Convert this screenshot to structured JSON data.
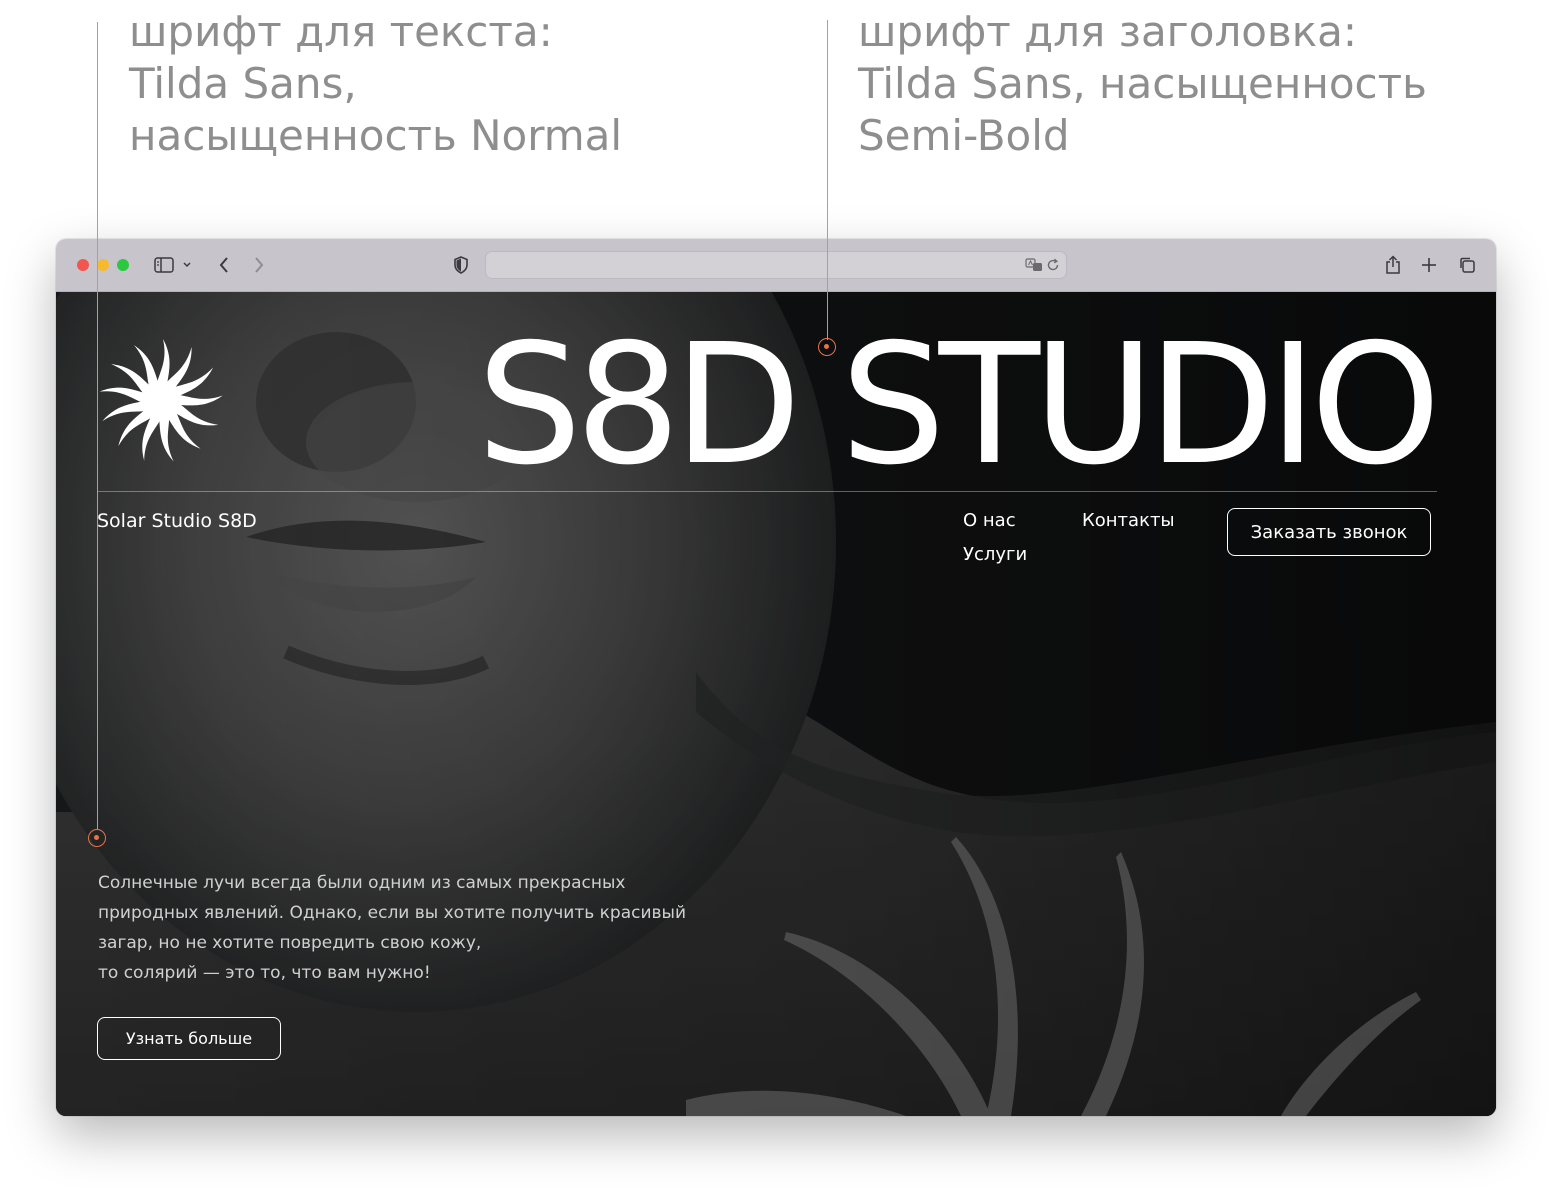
{
  "annotations": {
    "text_font": [
      "шрифт для текста:",
      "Tilda Sans,",
      "насыщенность Normal"
    ],
    "heading_font": [
      "шрифт для заголовка:",
      "Tilda Sans, насыщенность",
      "Semi-Bold"
    ]
  },
  "browser": {
    "address_value": "",
    "icons": [
      "sidebar-icon",
      "chevron-down-icon",
      "back-icon",
      "forward-icon",
      "shield-icon",
      "translate-icon",
      "reload-icon",
      "share-icon",
      "plus-icon",
      "tabs-icon"
    ]
  },
  "site": {
    "title": "S8D STUDIO",
    "brand_name": "Solar Studio S8D",
    "nav": {
      "about": "О нас",
      "services": "Услуги",
      "contacts": "Контакты"
    },
    "call_button": "Заказать звонок",
    "hero_text": [
      "Солнечные лучи всегда были одним из самых прекрасных",
      "природных явлений. Однако, если вы хотите получить красивый",
      "загар, но не хотите повредить свою кожу,",
      "то солярий — это то, что вам нужно!"
    ],
    "more_button": "Узнать больше"
  },
  "colors": {
    "accent": "#e8734a",
    "background": "#1a1b1c",
    "toolbar": "#c8c4cb",
    "text_light": "#ffffff"
  }
}
